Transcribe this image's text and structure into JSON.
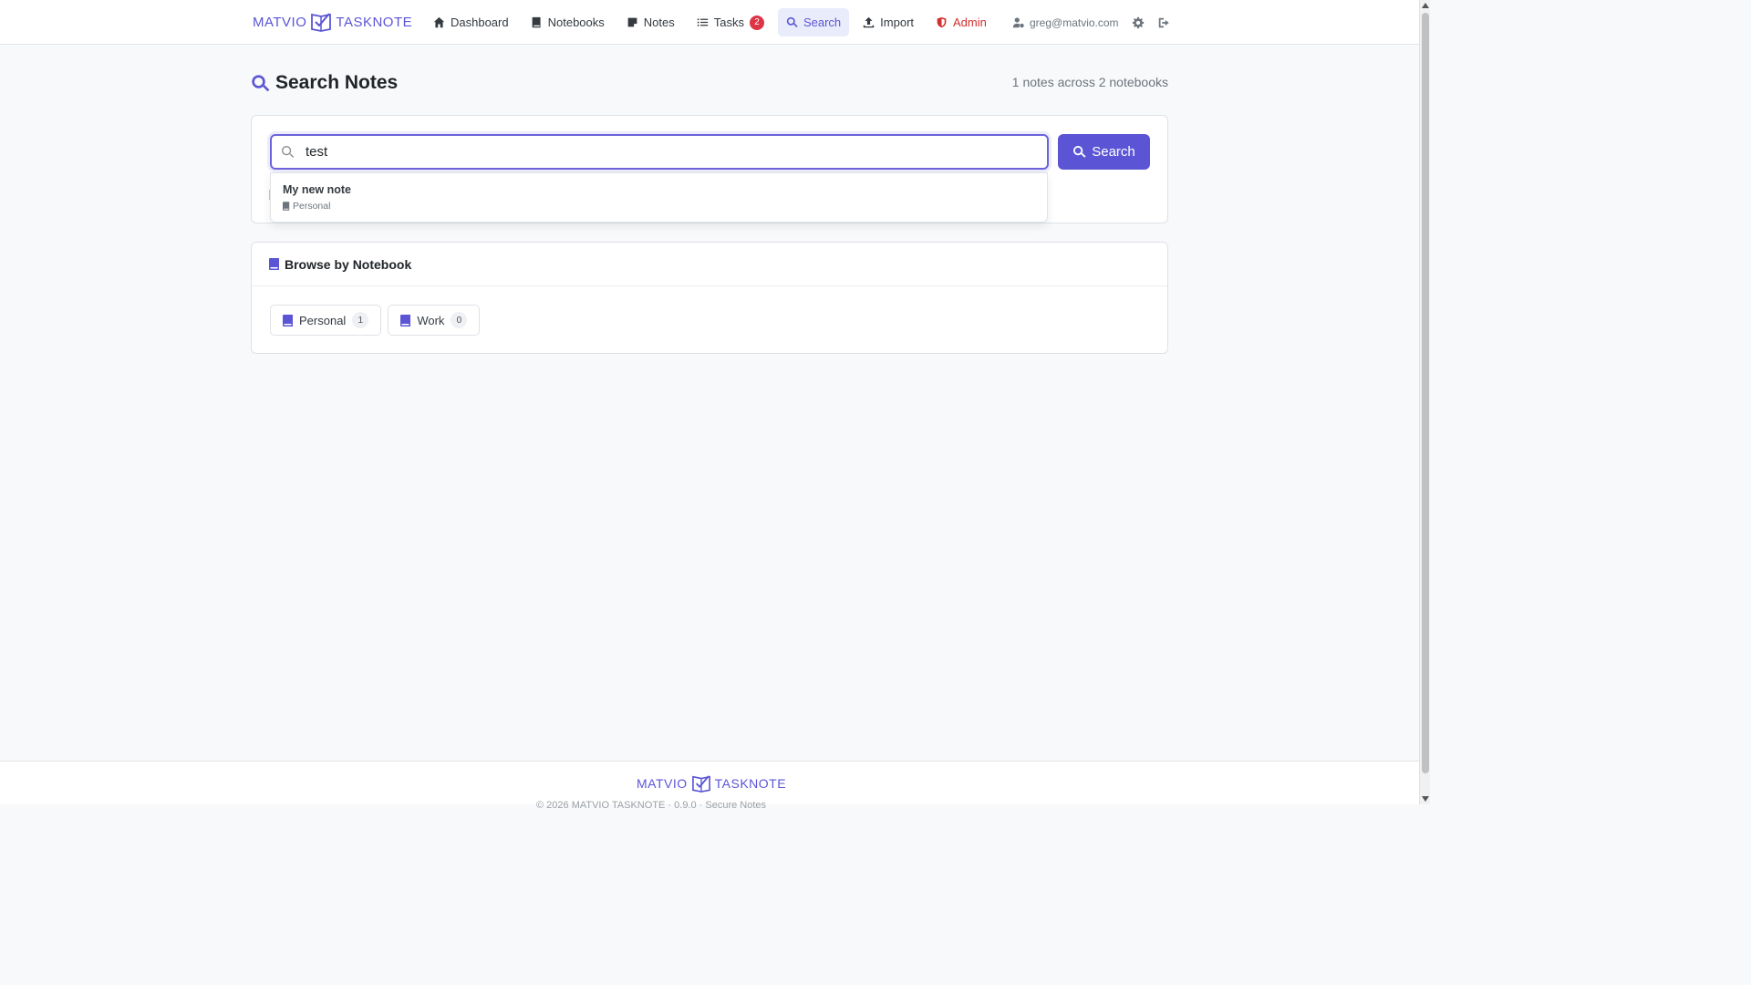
{
  "brand": {
    "left": "MATVIO",
    "right": "TASKNOTE"
  },
  "nav": {
    "dashboard": "Dashboard",
    "notebooks": "Notebooks",
    "notes": "Notes",
    "tasks": "Tasks",
    "tasks_badge": "2",
    "search": "Search",
    "import": "Import",
    "admin": "Admin",
    "user_email": "greg@matvio.com"
  },
  "page": {
    "title": "Search Notes",
    "summary": "1 notes across 2 notebooks"
  },
  "search": {
    "value": "test",
    "button_label": "Search"
  },
  "results": [
    {
      "title": "My new note",
      "notebook": "Personal"
    }
  ],
  "browse": {
    "title": "Browse by Notebook",
    "notebooks": [
      {
        "name": "Personal",
        "count": "1"
      },
      {
        "name": "Work",
        "count": "0"
      }
    ]
  },
  "footer": {
    "brand_left": "MATVIO",
    "brand_right": "TASKNOTE",
    "copyright": "© 2026 MATVIO TASKNOTE · 0.9.0 · Secure Notes"
  },
  "colors": {
    "accent": "#5b55d6",
    "admin": "#d0302f",
    "badge": "#dc3545"
  }
}
